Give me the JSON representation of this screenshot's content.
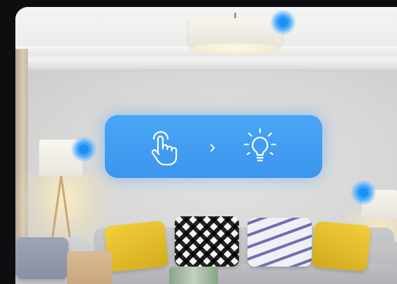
{
  "scene": {
    "room": "living-room",
    "accent_color": "#3b95ee"
  },
  "control_card": {
    "left_icon": "hand-tap-icon",
    "arrow_glyph": "›",
    "right_icon": "light-bulb-icon"
  },
  "indicators": [
    "ceiling-light-dot",
    "floor-lamp-dot",
    "side-lamp-dot"
  ]
}
